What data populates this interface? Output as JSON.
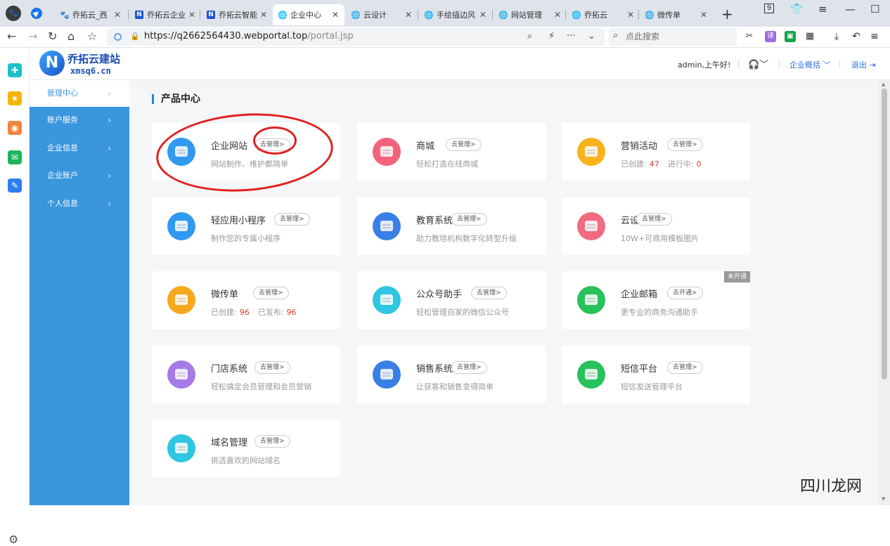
{
  "browser": {
    "tabs": [
      {
        "label": "乔拓云_西",
        "icon": "paw"
      },
      {
        "label": "乔拓云企业",
        "icon": "n"
      },
      {
        "label": "乔拓云智能",
        "icon": "n"
      },
      {
        "label": "企业中心",
        "icon": "globe",
        "active": true
      },
      {
        "label": "云设计",
        "icon": "globe"
      },
      {
        "label": "手绘插边风",
        "icon": "globe"
      },
      {
        "label": "网站管理",
        "icon": "globe"
      },
      {
        "label": "乔拓云",
        "icon": "globe"
      },
      {
        "label": "微传单",
        "icon": "globe"
      }
    ],
    "window_badge": "9",
    "url_host": "https://q2662564430.webportal.top",
    "url_path": "/portal.jsp",
    "search_placeholder": "点此搜索"
  },
  "app": {
    "logo_title": "乔拓云建站",
    "logo_sub": "xmsq6.cn",
    "greeting": "admin,上午好!",
    "overview_label": "企业概括 ﹀",
    "logout_label": "退出 ⇥",
    "nav": [
      {
        "label": "管理中心",
        "active": true
      },
      {
        "label": "账户服务"
      },
      {
        "label": "企业信息"
      },
      {
        "label": "企业账户"
      },
      {
        "label": "个人信息"
      }
    ],
    "section_title": "产品中心",
    "cards": [
      {
        "title": "企业网站",
        "btn": "去管理>",
        "desc": "网站制作、维护都简单",
        "color": "#2f9af0"
      },
      {
        "title": "商城",
        "btn": "去管理>",
        "desc": "轻松打造在线商城",
        "color": "#f2647a"
      },
      {
        "title": "营销活动",
        "btn": "去管理>",
        "desc_pre": "已创建:",
        "n1": "47",
        "desc_mid": "进行中:",
        "n2": "0",
        "color": "#f8b21c"
      },
      {
        "title": "轻应用小程序",
        "btn": "去管理>",
        "desc": "制作您的专属小程序",
        "color": "#2f9af0"
      },
      {
        "title": "教育系统",
        "btn": "去管理>",
        "desc": "助力教培机构数字化转型升级",
        "color": "#3a7fe6"
      },
      {
        "title": "云设计",
        "btn": "去管理>",
        "desc": "10W+可商用模板图片",
        "color": "#f06a80"
      },
      {
        "title": "微传单",
        "btn": "去管理>",
        "desc_pre": "已创建:",
        "n1": "96",
        "desc_mid": "已发布:",
        "n2": "96",
        "color": "#f8a81c"
      },
      {
        "title": "公众号助手",
        "btn": "去管理>",
        "desc": "轻松管理自家的微信公众号",
        "color": "#2ec6e0"
      },
      {
        "title": "企业邮箱",
        "btn": "去开通>",
        "desc": "更专业的商务沟通助手",
        "badge": "未开通",
        "color": "#27c25b"
      },
      {
        "title": "门店系统",
        "btn": "去管理>",
        "desc": "轻松搞定会员管理和会员营销",
        "color": "#a77ae8"
      },
      {
        "title": "销售系统",
        "btn": "去管理>",
        "desc": "让获客和销售变得简单",
        "color": "#3a7fe6"
      },
      {
        "title": "短信平台",
        "btn": "去管理>",
        "desc": "短信发送管理平台",
        "color": "#27c25b"
      },
      {
        "title": "域名管理",
        "btn": "去管理>",
        "desc": "挑选喜欢的网站域名",
        "color": "#2ec6e0"
      }
    ]
  },
  "watermark": "四川龙网"
}
